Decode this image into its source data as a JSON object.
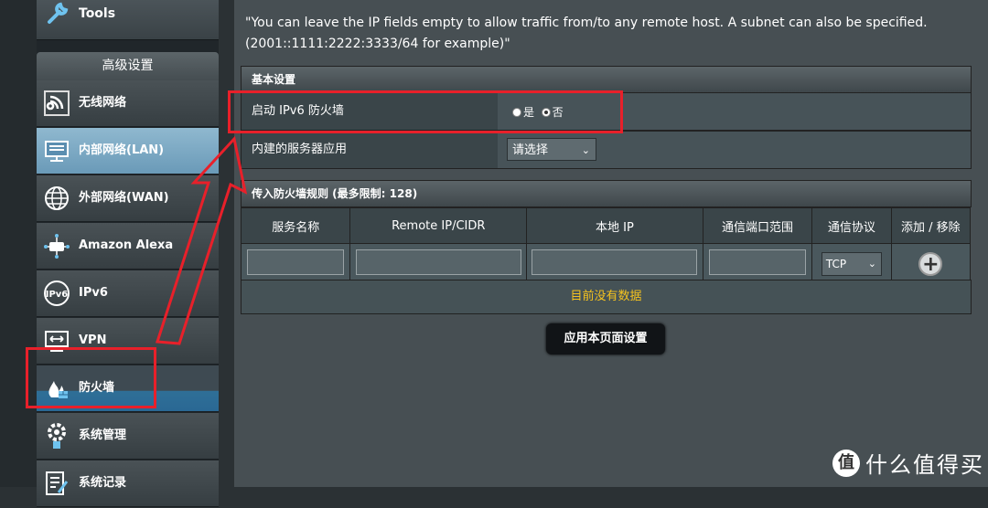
{
  "sidebar": {
    "tools_label": "Tools",
    "section_title": "高级设置",
    "items": [
      {
        "label": "无线网络",
        "icon": "wifi-icon"
      },
      {
        "label": "内部网络(LAN)",
        "icon": "lan-icon"
      },
      {
        "label": "外部网络(WAN)",
        "icon": "globe-icon"
      },
      {
        "label": "Amazon Alexa",
        "icon": "alexa-icon"
      },
      {
        "label": "IPv6",
        "icon": "ipv6-icon"
      },
      {
        "label": "VPN",
        "icon": "vpn-icon"
      },
      {
        "label": "防火墙",
        "icon": "firewall-icon"
      },
      {
        "label": "系统管理",
        "icon": "gear-icon"
      },
      {
        "label": "系统记录",
        "icon": "log-icon"
      }
    ]
  },
  "main": {
    "note": "\"You can leave the IP fields empty to allow traffic from/to any remote host. A subnet can also be specified. (2001::1111:2222:3333/64 for example)\"",
    "basic": {
      "title": "基本设置",
      "enable_label": "启动 IPv6 防火墙",
      "yes_label": "是",
      "no_label": "否",
      "server_label": "内建的服务器应用",
      "server_select": "请选择"
    },
    "rules": {
      "title": "传入防火墙规则 (最多限制: 128)",
      "columns": [
        "服务名称",
        "Remote IP/CIDR",
        "本地 IP",
        "通信端口范围",
        "通信协议",
        "添加 / 移除"
      ],
      "protocol_value": "TCP",
      "empty_text": "目前没有数据"
    },
    "apply_label": "应用本页面设置"
  },
  "watermark": {
    "icon_char": "值",
    "text": "什么值得买"
  },
  "colors": {
    "highlight": "#e8202a",
    "nodata_text": "#f4c21f",
    "lan_active": "#7aaac6"
  }
}
